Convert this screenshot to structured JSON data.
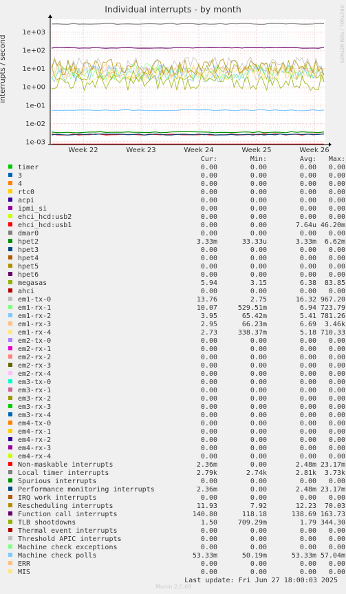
{
  "title": "Individual interrupts - by month",
  "side_note": "RRDTOOL / TOBI OETIKER",
  "footer": "Last update: Fri Jun 27 18:00:03 2025",
  "watermark": "Munin 2.0.69",
  "legend_headers": {
    "cur": "Cur:",
    "min": "Min:",
    "avg": "Avg:",
    "max": "Max:"
  },
  "chart_data": {
    "type": "line",
    "title": "Individual interrupts - by month",
    "ylabel": "interrupts / second",
    "yscale": "log",
    "yticks": [
      "1e-03",
      "1e-02",
      "1e-01",
      "1e+00",
      "1e+01",
      "1e+02",
      "1e+03"
    ],
    "ylim": [
      0.0007,
      5000
    ],
    "xticks": [
      "Week 22",
      "Week 23",
      "Week 24",
      "Week 25",
      "Week 26"
    ],
    "grid": true,
    "series": [
      {
        "name": "timer",
        "color": "#00cc00",
        "cur": "0.00",
        "min": "0.00",
        "avg": "0.00",
        "max": "0.00",
        "level": 0
      },
      {
        "name": "3",
        "color": "#0066b3",
        "cur": "0.00",
        "min": "0.00",
        "avg": "0.00",
        "max": "0.00",
        "level": 0
      },
      {
        "name": "4",
        "color": "#ff8000",
        "cur": "0.00",
        "min": "0.00",
        "avg": "0.00",
        "max": "0.00",
        "level": 0
      },
      {
        "name": "rtc0",
        "color": "#ffcc00",
        "cur": "0.00",
        "min": "0.00",
        "avg": "0.00",
        "max": "0.00",
        "level": 0
      },
      {
        "name": "acpi",
        "color": "#330099",
        "cur": "0.00",
        "min": "0.00",
        "avg": "0.00",
        "max": "0.00",
        "level": 0
      },
      {
        "name": "ipmi_si",
        "color": "#990099",
        "cur": "0.00",
        "min": "0.00",
        "avg": "0.00",
        "max": "0.00",
        "level": 0
      },
      {
        "name": "ehci_hcd:usb2",
        "color": "#ccff00",
        "cur": "0.00",
        "min": "0.00",
        "avg": "0.00",
        "max": "0.00",
        "level": 0
      },
      {
        "name": "ehci_hcd:usb1",
        "color": "#ff0000",
        "cur": "0.00",
        "min": "0.00",
        "avg": "7.64u",
        "max": "46.20m",
        "level": 7.6e-06
      },
      {
        "name": "dmar0",
        "color": "#808080",
        "cur": "0.00",
        "min": "0.00",
        "avg": "0.00",
        "max": "0.00",
        "level": 0
      },
      {
        "name": "hpet2",
        "color": "#008f00",
        "cur": "3.33m",
        "min": "33.33u",
        "avg": "3.33m",
        "max": "6.62m",
        "level": 0.0033
      },
      {
        "name": "hpet3",
        "color": "#00487d",
        "cur": "0.00",
        "min": "0.00",
        "avg": "0.00",
        "max": "0.00",
        "level": 0
      },
      {
        "name": "hpet4",
        "color": "#b35a00",
        "cur": "0.00",
        "min": "0.00",
        "avg": "0.00",
        "max": "0.00",
        "level": 0
      },
      {
        "name": "hpet5",
        "color": "#b38f00",
        "cur": "0.00",
        "min": "0.00",
        "avg": "0.00",
        "max": "0.00",
        "level": 0
      },
      {
        "name": "hpet6",
        "color": "#6b006b",
        "cur": "0.00",
        "min": "0.00",
        "avg": "0.00",
        "max": "0.00",
        "level": 0
      },
      {
        "name": "megasas",
        "color": "#8fb300",
        "cur": "5.94",
        "min": "3.15",
        "avg": "6.38",
        "max": "83.85",
        "level": 6.38
      },
      {
        "name": "ahci",
        "color": "#b30000",
        "cur": "0.00",
        "min": "0.00",
        "avg": "0.00",
        "max": "0.00",
        "level": 0
      },
      {
        "name": "em1-tx-0",
        "color": "#bebebe",
        "cur": "13.76",
        "min": "2.75",
        "avg": "16.32",
        "max": "967.20",
        "level": 16.32
      },
      {
        "name": "em1-rx-1",
        "color": "#80ff80",
        "cur": "10.07",
        "min": "529.51m",
        "avg": "6.94",
        "max": "723.79",
        "level": 6.94
      },
      {
        "name": "em1-rx-2",
        "color": "#80c9ff",
        "cur": "3.95",
        "min": "65.42m",
        "avg": "5.41",
        "max": "781.26",
        "level": 5.41
      },
      {
        "name": "em1-rx-3",
        "color": "#ffc080",
        "cur": "2.95",
        "min": "66.23m",
        "avg": "6.69",
        "max": "3.46k",
        "level": 6.69
      },
      {
        "name": "em1-rx-4",
        "color": "#ffe680",
        "cur": "2.73",
        "min": "338.37m",
        "avg": "5.18",
        "max": "710.33",
        "level": 5.18
      },
      {
        "name": "em2-tx-0",
        "color": "#aa80ff",
        "cur": "0.00",
        "min": "0.00",
        "avg": "0.00",
        "max": "0.00",
        "level": 0
      },
      {
        "name": "em2-rx-1",
        "color": "#ee00cc",
        "cur": "0.00",
        "min": "0.00",
        "avg": "0.00",
        "max": "0.00",
        "level": 0
      },
      {
        "name": "em2-rx-2",
        "color": "#ff8080",
        "cur": "0.00",
        "min": "0.00",
        "avg": "0.00",
        "max": "0.00",
        "level": 0
      },
      {
        "name": "em2-rx-3",
        "color": "#666600",
        "cur": "0.00",
        "min": "0.00",
        "avg": "0.00",
        "max": "0.00",
        "level": 0
      },
      {
        "name": "em2-rx-4",
        "color": "#ffbfff",
        "cur": "0.00",
        "min": "0.00",
        "avg": "0.00",
        "max": "0.00",
        "level": 0
      },
      {
        "name": "em3-tx-0",
        "color": "#00ffcc",
        "cur": "0.00",
        "min": "0.00",
        "avg": "0.00",
        "max": "0.00",
        "level": 0
      },
      {
        "name": "em3-rx-1",
        "color": "#cc6699",
        "cur": "0.00",
        "min": "0.00",
        "avg": "0.00",
        "max": "0.00",
        "level": 0
      },
      {
        "name": "em3-rx-2",
        "color": "#999900",
        "cur": "0.00",
        "min": "0.00",
        "avg": "0.00",
        "max": "0.00",
        "level": 0
      },
      {
        "name": "em3-rx-3",
        "color": "#00cc00",
        "cur": "0.00",
        "min": "0.00",
        "avg": "0.00",
        "max": "0.00",
        "level": 0
      },
      {
        "name": "em3-rx-4",
        "color": "#0066b3",
        "cur": "0.00",
        "min": "0.00",
        "avg": "0.00",
        "max": "0.00",
        "level": 0
      },
      {
        "name": "em4-tx-0",
        "color": "#ff8000",
        "cur": "0.00",
        "min": "0.00",
        "avg": "0.00",
        "max": "0.00",
        "level": 0
      },
      {
        "name": "em4-rx-1",
        "color": "#ffcc00",
        "cur": "0.00",
        "min": "0.00",
        "avg": "0.00",
        "max": "0.00",
        "level": 0
      },
      {
        "name": "em4-rx-2",
        "color": "#330099",
        "cur": "0.00",
        "min": "0.00",
        "avg": "0.00",
        "max": "0.00",
        "level": 0
      },
      {
        "name": "em4-rx-3",
        "color": "#990099",
        "cur": "0.00",
        "min": "0.00",
        "avg": "0.00",
        "max": "0.00",
        "level": 0
      },
      {
        "name": "em4-rx-4",
        "color": "#ccff00",
        "cur": "0.00",
        "min": "0.00",
        "avg": "0.00",
        "max": "0.00",
        "level": 0
      },
      {
        "name": "Non-maskable interrupts",
        "color": "#ff0000",
        "cur": "2.36m",
        "min": "0.00",
        "avg": "2.48m",
        "max": "23.17m",
        "level": 0.00248
      },
      {
        "name": "Local timer interrupts",
        "color": "#808080",
        "cur": "2.79k",
        "min": "2.74k",
        "avg": "2.81k",
        "max": "3.73k",
        "level": 2810
      },
      {
        "name": "Spurious interrupts",
        "color": "#008f00",
        "cur": "0.00",
        "min": "0.00",
        "avg": "0.00",
        "max": "0.00",
        "level": 0
      },
      {
        "name": "Performance monitoring interrupts",
        "color": "#00487d",
        "cur": "2.36m",
        "min": "0.00",
        "avg": "2.48m",
        "max": "23.17m",
        "level": 0.00248
      },
      {
        "name": "IRQ work interrupts",
        "color": "#b35a00",
        "cur": "0.00",
        "min": "0.00",
        "avg": "0.00",
        "max": "0.00",
        "level": 0
      },
      {
        "name": "Rescheduling interrupts",
        "color": "#b38f00",
        "cur": "11.93",
        "min": "7.92",
        "avg": "12.23",
        "max": "70.03",
        "level": 12.23
      },
      {
        "name": "Function call interrupts",
        "color": "#6b006b",
        "cur": "140.80",
        "min": "118.18",
        "avg": "138.69",
        "max": "163.73",
        "level": 138.69
      },
      {
        "name": "TLB shootdowns",
        "color": "#8fb300",
        "cur": "1.50",
        "min": "709.29m",
        "avg": "1.79",
        "max": "344.30",
        "level": 1.79
      },
      {
        "name": "Thermal event interrupts",
        "color": "#b30000",
        "cur": "0.00",
        "min": "0.00",
        "avg": "0.00",
        "max": "0.00",
        "level": 0
      },
      {
        "name": "Threshold APIC interrupts",
        "color": "#bebebe",
        "cur": "0.00",
        "min": "0.00",
        "avg": "0.00",
        "max": "0.00",
        "level": 0
      },
      {
        "name": "Machine check exceptions",
        "color": "#80ff80",
        "cur": "0.00",
        "min": "0.00",
        "avg": "0.00",
        "max": "0.00",
        "level": 0
      },
      {
        "name": "Machine check polls",
        "color": "#80c9ff",
        "cur": "53.33m",
        "min": "50.19m",
        "avg": "53.33m",
        "max": "57.04m",
        "level": 0.0533
      },
      {
        "name": "ERR",
        "color": "#ffc080",
        "cur": "0.00",
        "min": "0.00",
        "avg": "0.00",
        "max": "0.00",
        "level": 0
      },
      {
        "name": "MIS",
        "color": "#ffe680",
        "cur": "0.00",
        "min": "0.00",
        "avg": "0.00",
        "max": "0.00",
        "level": 0
      }
    ]
  }
}
